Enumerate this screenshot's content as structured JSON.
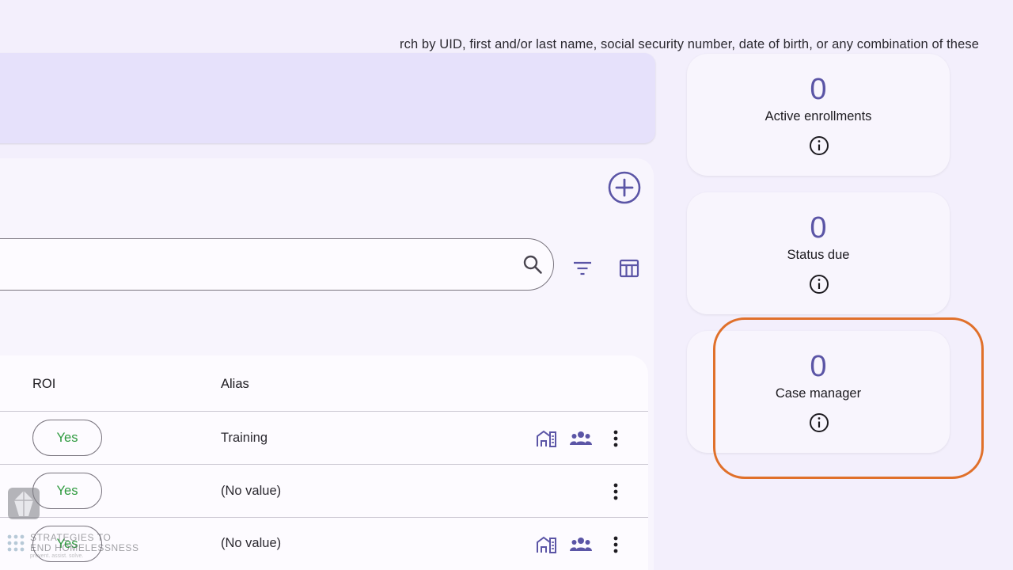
{
  "search_hint": {
    "text": "rch by UID, first and/or last name, social security number, date of birth, or any combination of these"
  },
  "search": {
    "value": "",
    "placeholder": ""
  },
  "table": {
    "columns": [
      "ROI",
      "Alias"
    ],
    "rows": [
      {
        "roi": "Yes",
        "alias": "Training",
        "has_enrollment_icons": true
      },
      {
        "roi": "Yes",
        "alias": "(No value)",
        "has_enrollment_icons": false
      },
      {
        "roi": "Yes",
        "alias": "(No value)",
        "has_enrollment_icons": true
      }
    ]
  },
  "stats": [
    {
      "value": "0",
      "label": "Active enrollments"
    },
    {
      "value": "0",
      "label": "Status due"
    },
    {
      "value": "0",
      "label": "Case manager"
    }
  ],
  "watermark": {
    "line1": "STRATEGIES TO",
    "line2": "END HOMELESSNESS",
    "tagline": "prevent. assist. solve."
  },
  "colors": {
    "accent": "#5b55a6",
    "yes_green": "#2e9a3e",
    "highlight": "#e0702a"
  },
  "icons": {
    "add": "add-circle-icon",
    "search": "search-icon",
    "filter": "filter-icon",
    "columns": "view-columns-icon",
    "info": "info-icon",
    "housing": "housing-icon",
    "household": "household-icon",
    "more": "more-vert-icon"
  }
}
